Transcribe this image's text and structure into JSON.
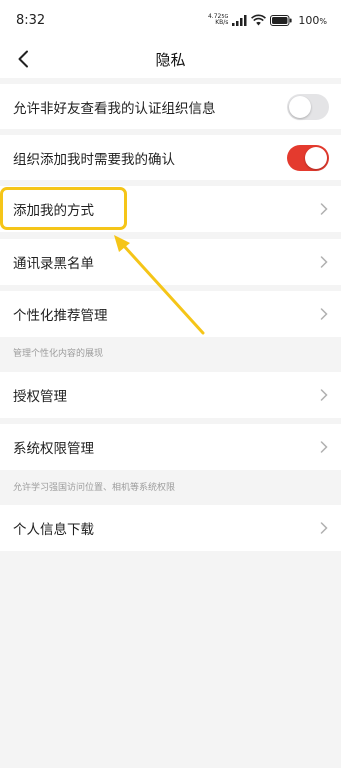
{
  "status_bar": {
    "time": "8:32",
    "net_speed_value": "4.72",
    "net_speed_unit": "KB/s",
    "net_type": "5G",
    "battery_percent": "100"
  },
  "nav": {
    "title": "隐私"
  },
  "settings": {
    "allow_non_friend_view": {
      "label": "允许非好友查看我的认证组织信息",
      "enabled": false
    },
    "org_add_confirm": {
      "label": "组织添加我时需要我的确认",
      "enabled": true
    },
    "add_me_methods": {
      "label": "添加我的方式"
    },
    "contacts_blacklist": {
      "label": "通讯录黑名单"
    },
    "personalized_recommend": {
      "label": "个性化推荐管理",
      "hint": "管理个性化内容的展现"
    },
    "authorization": {
      "label": "授权管理"
    },
    "system_permissions": {
      "label": "系统权限管理",
      "hint": "允许学习强国访问位置、相机等系统权限"
    },
    "personal_info_download": {
      "label": "个人信息下载"
    }
  },
  "colors": {
    "toggle_on": "#e43a2e",
    "toggle_off": "#e4e4e6",
    "highlight": "#f5c518",
    "background": "#f4f4f4"
  }
}
